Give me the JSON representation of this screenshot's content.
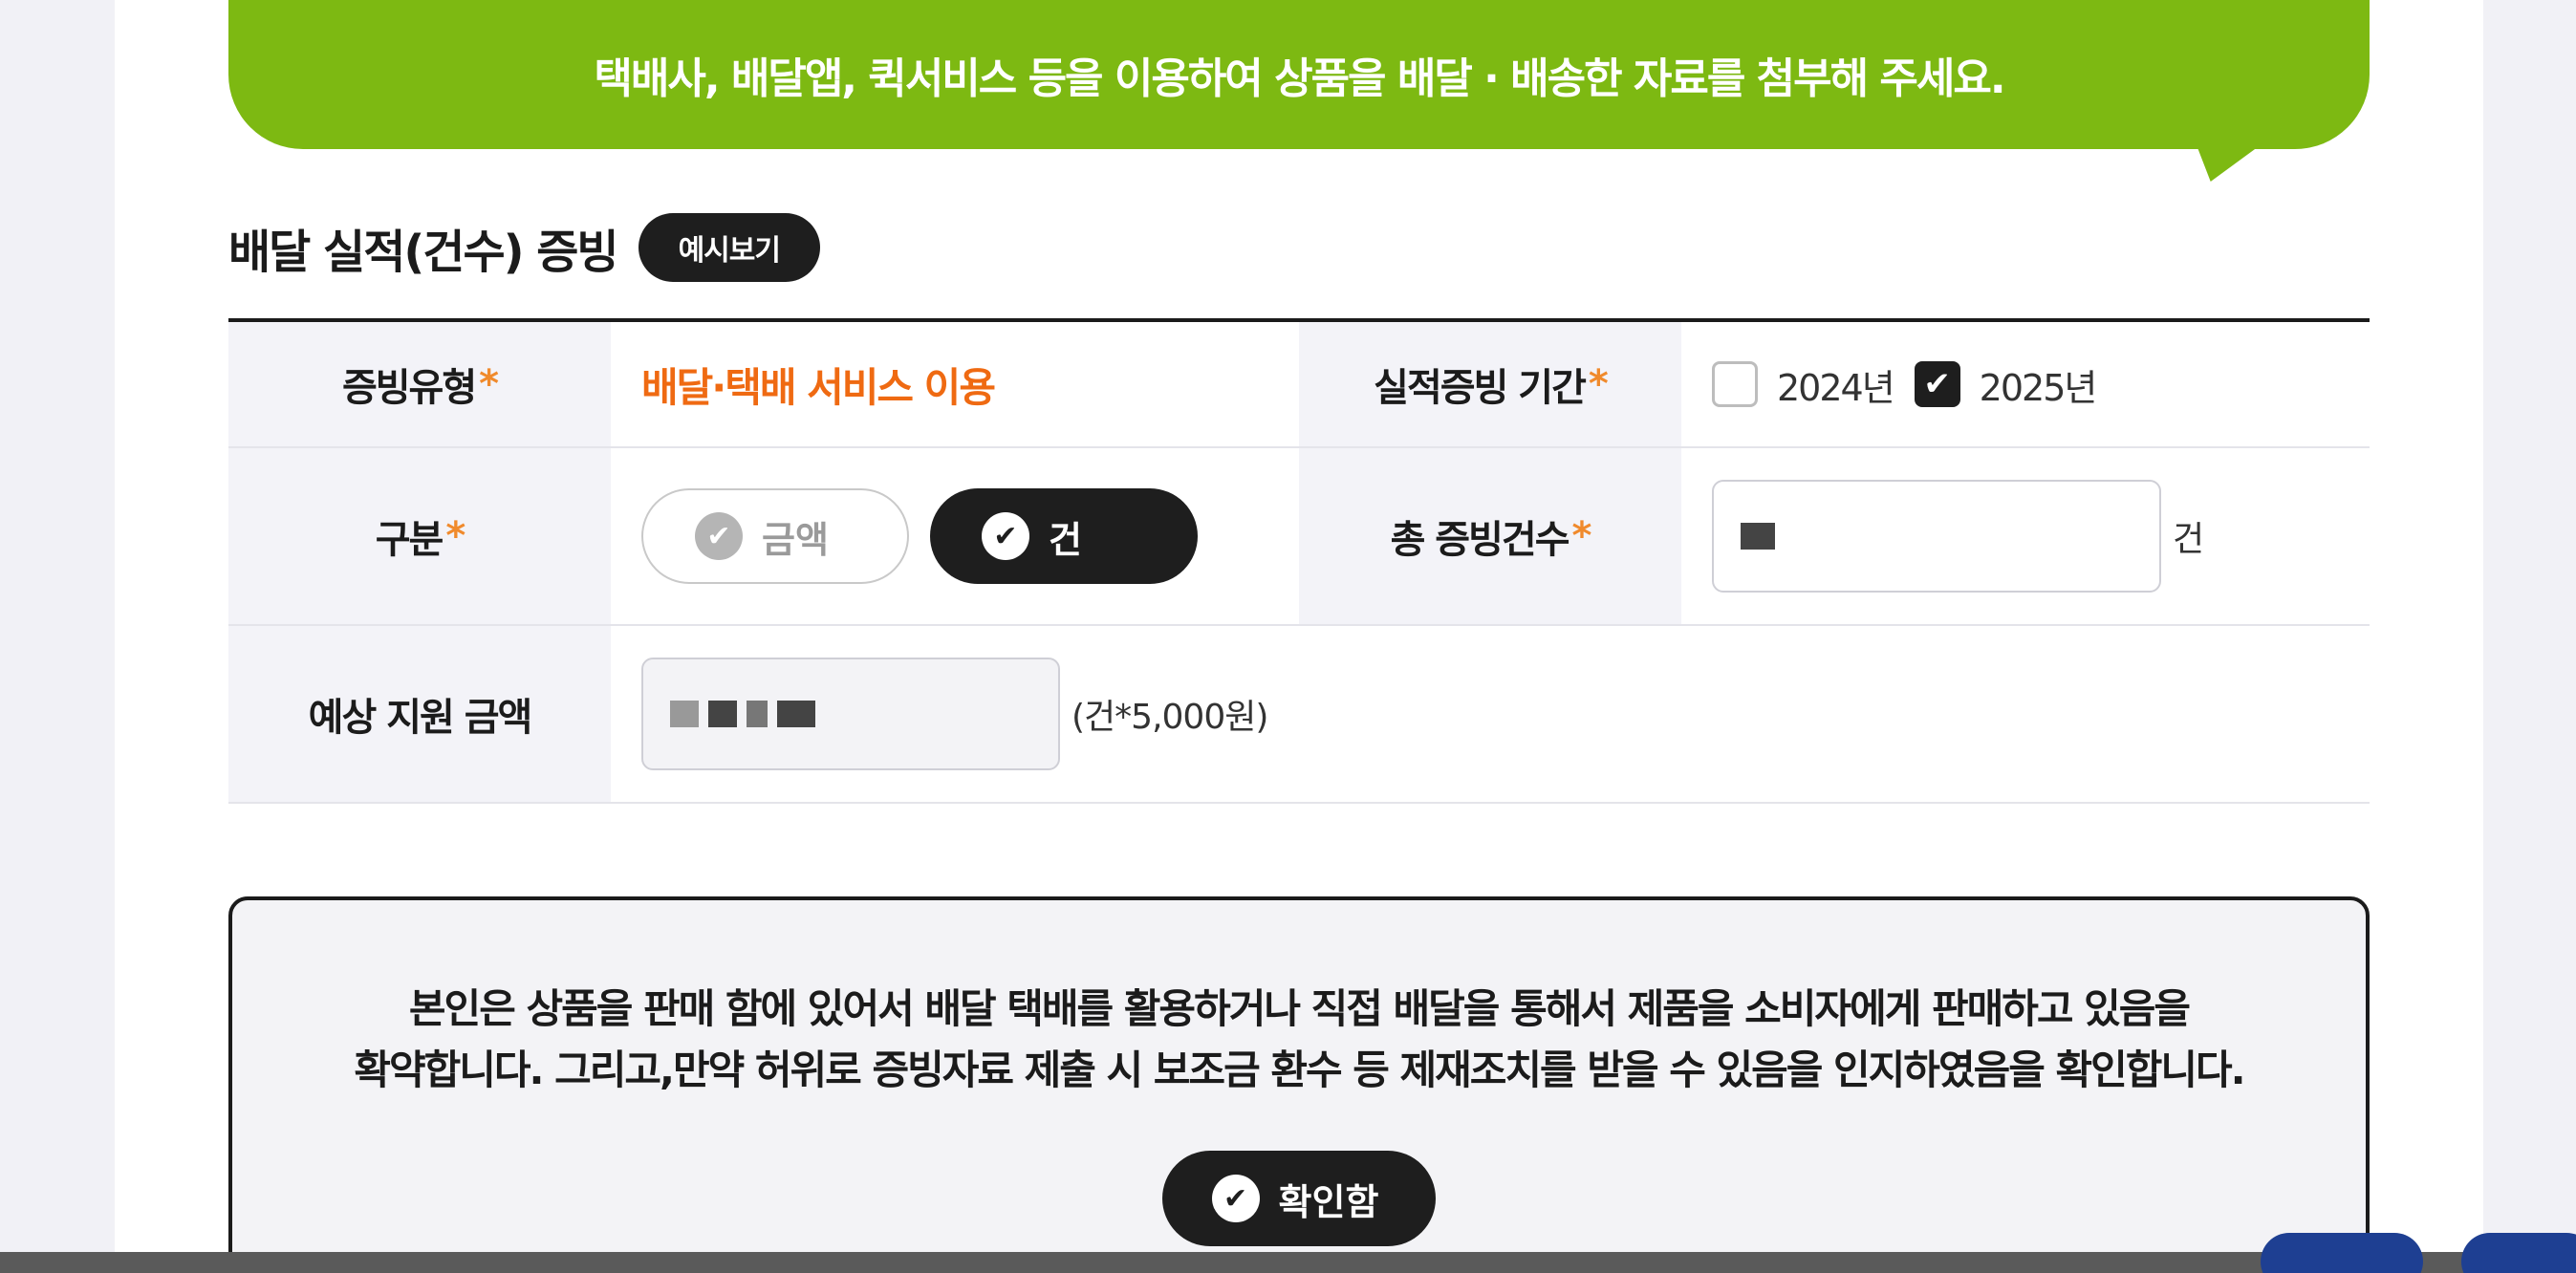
{
  "banner": {
    "text": "택배사, 배달앱, 퀵서비스 등을 이용하여 상품을 배달 · 배송한 자료를 첨부해 주세요."
  },
  "section": {
    "title": "배달 실적(건수) 증빙",
    "example_button": "예시보기"
  },
  "form": {
    "proof_type_label": "증빙유형",
    "proof_type_value": "배달·택배 서비스 이용",
    "period_label": "실적증빙 기간",
    "period_options": [
      {
        "label": "2024년",
        "checked": false
      },
      {
        "label": "2025년",
        "checked": true
      }
    ],
    "category_label": "구분",
    "category_options": [
      {
        "label": "금액",
        "selected": false
      },
      {
        "label": "건",
        "selected": true
      }
    ],
    "total_count_label": "총 증빙건수",
    "total_count_unit": "건",
    "estimated_label": "예상 지원 금액",
    "estimated_note": "(건*5,000원)",
    "required_mark": "*"
  },
  "agreement": {
    "line1": "본인은 상품을 판매 함에 있어서 배달 택배를 활용하거나 직접 배달을 통해서 제품을 소비자에게 판매하고 있음을",
    "line2": "확약합니다. 그리고,만약 허위로 증빙자료 제출 시 보조금 환수 등 제재조치를 받을 수 있음을 인지하였음을 확인합니다.",
    "confirm_button": "확인함"
  },
  "icons": {
    "check": "check-icon",
    "circle_check": "circle-check-icon"
  },
  "colors": {
    "banner_green": "#7db912",
    "accent_orange": "#ef6a12",
    "dark": "#1e1e1e"
  }
}
